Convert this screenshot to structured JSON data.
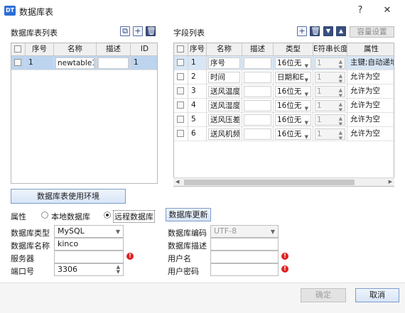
{
  "window": {
    "icon_text": "DT",
    "title": "数据库表",
    "help": "?",
    "close": "✕"
  },
  "left_pane": {
    "label": "数据库表列表",
    "columns": [
      "序号",
      "名称",
      "描述",
      "ID"
    ],
    "rows": [
      {
        "seq": "1",
        "name": "newtable1",
        "desc": "",
        "id": "1",
        "selected": true
      }
    ]
  },
  "right_pane": {
    "label": "字段列表",
    "capacity_button": "容量设置",
    "columns": [
      "序号",
      "名称",
      "描述",
      "类型",
      "E符串长度",
      "属性"
    ],
    "rows": [
      {
        "seq": "1",
        "name": "序号",
        "desc": "",
        "type": "16位无",
        "len": "1",
        "attr": "主键;自动递增"
      },
      {
        "seq": "2",
        "name": "时间",
        "desc": "",
        "type": "日期和E",
        "len": "1",
        "attr": "允许为空"
      },
      {
        "seq": "3",
        "name": "送风温度",
        "desc": "",
        "type": "16位无",
        "len": "1",
        "attr": "允许为空"
      },
      {
        "seq": "4",
        "name": "送风湿度",
        "desc": "",
        "type": "16位无",
        "len": "1",
        "attr": "允许为空"
      },
      {
        "seq": "5",
        "name": "送风压差",
        "desc": "",
        "type": "16位无",
        "len": "1",
        "attr": "允许为空"
      },
      {
        "seq": "6",
        "name": "送风机频率",
        "desc": "",
        "type": "16位无",
        "len": "1",
        "attr": "允许为空"
      }
    ],
    "scroll_left": "◀",
    "scroll_right": "▶"
  },
  "env_button": "数据库表使用环境",
  "property": {
    "label": "属性",
    "local": "本地数据库",
    "remote": "远程数据库",
    "selected": "remote",
    "update_button": "数据库更新"
  },
  "form": {
    "db_type_label": "数据库类型",
    "db_type_value": "MySQL",
    "db_name_label": "数据库名称",
    "db_name_value": "kinco",
    "server_label": "服务器",
    "server_value": "",
    "port_label": "端口号",
    "port_value": "3306",
    "encoding_label": "数据库编码",
    "encoding_value": "UTF-8",
    "db_desc_label": "数据库描述",
    "db_desc_value": "",
    "user_label": "用户名",
    "user_value": "",
    "password_label": "用户密码",
    "password_value": ""
  },
  "footer": {
    "ok": "确定",
    "cancel": "取消"
  },
  "colors": {
    "selected_row": "#bcd4ee",
    "button_border": "#7d9ccb",
    "warning": "#e02020",
    "toolbar_icon": "#3a4f7f"
  }
}
